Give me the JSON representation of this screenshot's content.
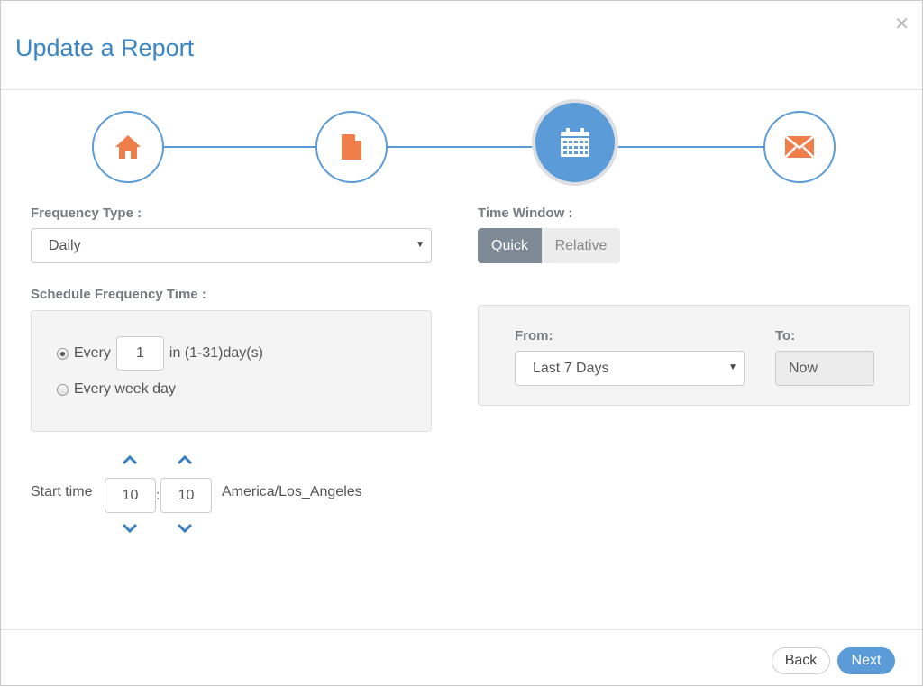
{
  "modal": {
    "title": "Update a Report",
    "close_icon": "close-icon"
  },
  "stepper": {
    "current_step": 3,
    "total_steps": 4,
    "steps": [
      {
        "icon": "home-icon",
        "state": "complete"
      },
      {
        "icon": "document-icon",
        "state": "complete"
      },
      {
        "icon": "calendar-icon",
        "state": "active"
      },
      {
        "icon": "envelope-icon",
        "state": "pending"
      }
    ]
  },
  "frequency": {
    "type_label": "Frequency Type :",
    "type_value": "Daily",
    "schedule_label": "Schedule Frequency Time :",
    "option_every_label": "Every",
    "option_every_selected": true,
    "every_value": "1",
    "every_suffix": "in (1-31)day(s)",
    "option_weekday_label": "Every week day",
    "option_weekday_selected": false
  },
  "start_time": {
    "label": "Start time",
    "hour": "10",
    "separator": ":",
    "minute": "10",
    "timezone": "America/Los_Angeles"
  },
  "time_window": {
    "label": "Time Window :",
    "tabs": [
      {
        "label": "Quick",
        "selected": true
      },
      {
        "label": "Relative",
        "selected": false
      }
    ],
    "from_label": "From:",
    "from_value": "Last 7 Days",
    "to_label": "To:",
    "to_value": "Now"
  },
  "footer": {
    "back_label": "Back",
    "next_label": "Next"
  },
  "colors": {
    "accent_blue": "#5b9bd8",
    "title_blue": "#3a85c4",
    "icon_orange": "#ef7e4a",
    "segment_active": "#7d8a96"
  }
}
